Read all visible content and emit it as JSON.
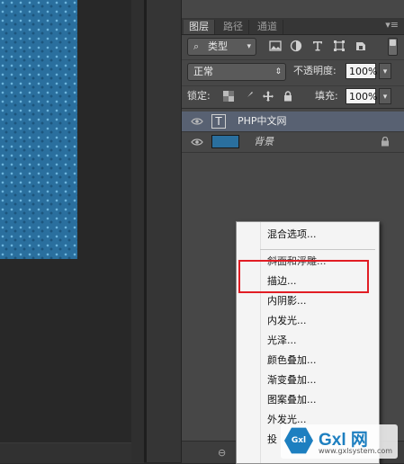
{
  "panel": {
    "tabs": [
      "图层",
      "路径",
      "通道"
    ],
    "menu_glyph": "▾≡",
    "filter": {
      "label": "类型",
      "icons": [
        "image-filter-icon",
        "adjustment-filter-icon",
        "text-filter-icon",
        "shape-filter-icon",
        "smartobject-filter-icon"
      ]
    },
    "blend": {
      "mode": "正常",
      "opacity_label": "不透明度:",
      "opacity_value": "100%"
    },
    "lock": {
      "label": "锁定:",
      "fill_label": "填充:",
      "fill_value": "100%"
    },
    "layers": [
      {
        "name": "PHP中文网",
        "kind": "text",
        "thumb_glyph": "T",
        "selected": true
      },
      {
        "name": "背景",
        "kind": "background",
        "locked": true,
        "selected": false
      }
    ]
  },
  "context_menu": {
    "items": [
      "混合选项...",
      "斜面和浮雕...",
      "描边...",
      "内阴影...",
      "内发光...",
      "光泽...",
      "颜色叠加...",
      "渐变叠加...",
      "图案叠加...",
      "外发光...",
      "投"
    ],
    "highlighted": "描边..."
  },
  "watermark": {
    "brand": "Gxl 网",
    "hex_text": "Gxl",
    "url": "www.gxlsystem.com"
  },
  "colors": {
    "canvas": "#2a6f9e",
    "panel": "#474747",
    "selected_layer": "#586172",
    "highlight_box": "#e11d24"
  }
}
